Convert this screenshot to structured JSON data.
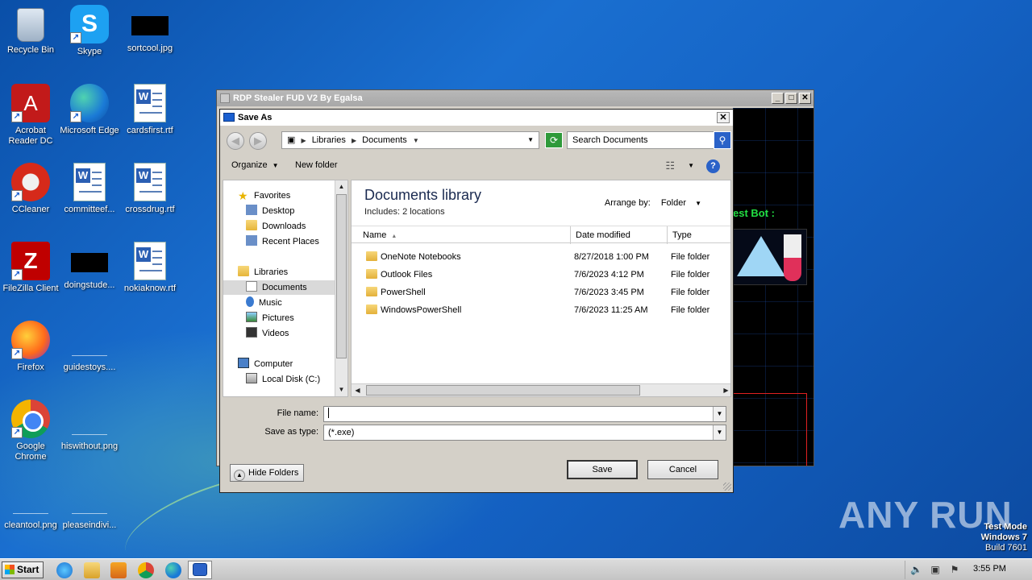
{
  "desktop": {
    "icons": [
      {
        "label": "Recycle Bin"
      },
      {
        "label": "Skype"
      },
      {
        "label": "sortcool.jpg"
      },
      {
        "label": "Acrobat Reader DC"
      },
      {
        "label": "Microsoft Edge"
      },
      {
        "label": "cardsfirst.rtf"
      },
      {
        "label": "CCleaner"
      },
      {
        "label": "committeef..."
      },
      {
        "label": "crossdrug.rtf"
      },
      {
        "label": "FileZilla Client"
      },
      {
        "label": "doingstude..."
      },
      {
        "label": "nokiaknow.rtf"
      },
      {
        "label": "Firefox"
      },
      {
        "label": "guidestoys...."
      },
      {
        "label": "Google Chrome"
      },
      {
        "label": "hiswithout.png"
      },
      {
        "label": "cleantool.png"
      },
      {
        "label": "pleaseindivi..."
      }
    ]
  },
  "parent_window": {
    "title": "RDP Stealer FUD V2 By Egalsa",
    "bot_label": "est Bot :",
    "controls": {
      "minimize": "_",
      "maximize": "□",
      "close": "✕"
    }
  },
  "dialog": {
    "title": "Save As",
    "close": "✕",
    "address": {
      "segments": [
        "Libraries",
        "Documents"
      ]
    },
    "search_placeholder": "Search Documents",
    "toolbar": {
      "organize": "Organize",
      "new_folder": "New folder",
      "help": "?"
    },
    "nav": {
      "favorites": "Favorites",
      "desktop": "Desktop",
      "downloads": "Downloads",
      "recent": "Recent Places",
      "libraries": "Libraries",
      "documents": "Documents",
      "music": "Music",
      "pictures": "Pictures",
      "videos": "Videos",
      "computer": "Computer",
      "local_disk": "Local Disk (C:)"
    },
    "library": {
      "title": "Documents library",
      "includes": "Includes:  2 locations",
      "arrange_label": "Arrange by:",
      "arrange_value": "Folder"
    },
    "columns": {
      "name": "Name",
      "date": "Date modified",
      "type": "Type"
    },
    "files": [
      {
        "name": "OneNote Notebooks",
        "date": "8/27/2018 1:00 PM",
        "type": "File folder"
      },
      {
        "name": "Outlook Files",
        "date": "7/6/2023 4:12 PM",
        "type": "File folder"
      },
      {
        "name": "PowerShell",
        "date": "7/6/2023 3:45 PM",
        "type": "File folder"
      },
      {
        "name": "WindowsPowerShell",
        "date": "7/6/2023 11:25 AM",
        "type": "File folder"
      }
    ],
    "file_name_label": "File name:",
    "file_name_value": "",
    "save_type_label": "Save as type:",
    "save_type_value": "(*.exe)",
    "save_button": "Save",
    "cancel_button": "Cancel",
    "hide_folders": "Hide Folders"
  },
  "watermark": "ANY RUN",
  "test_mode": {
    "line1": "Test Mode",
    "line2": "Windows 7",
    "line3": "Build 7601"
  },
  "taskbar": {
    "start": "Start",
    "clock": "3:55 PM"
  }
}
